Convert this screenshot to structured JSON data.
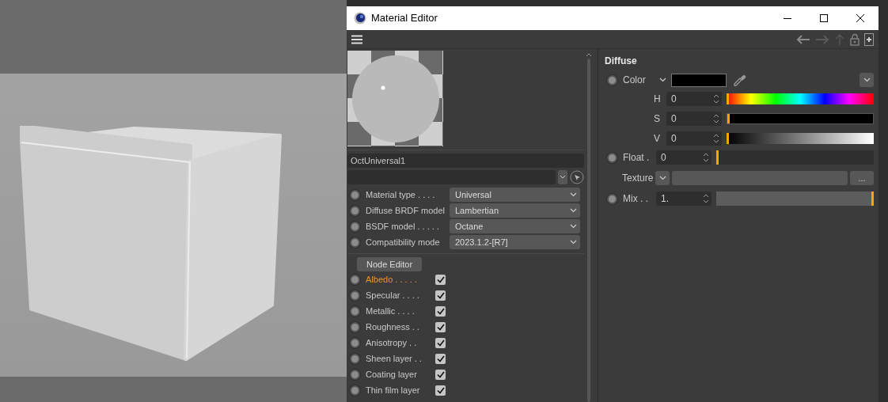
{
  "window": {
    "title": "Material Editor"
  },
  "material": {
    "name": "OctUniversal1",
    "properties": [
      {
        "label": "Material type . . . .",
        "value": "Universal"
      },
      {
        "label": "Diffuse BRDF model",
        "value": "Lambertian"
      },
      {
        "label": "BSDF model . . . . .",
        "value": "Octane"
      },
      {
        "label": "Compatibility mode",
        "value": "2023.1.2-[R7]"
      }
    ],
    "node_editor_button": "Node Editor",
    "channels": [
      {
        "label": "Albedo . . . . .",
        "selected": true,
        "checked": true
      },
      {
        "label": "Specular . . . .",
        "selected": false,
        "checked": true
      },
      {
        "label": "Metallic . . . .",
        "selected": false,
        "checked": true
      },
      {
        "label": "Roughness . .",
        "selected": false,
        "checked": true
      },
      {
        "label": "Anisotropy . .",
        "selected": false,
        "checked": true
      },
      {
        "label": "Sheen layer . .",
        "selected": false,
        "checked": true
      },
      {
        "label": "Coating layer",
        "selected": false,
        "checked": true
      },
      {
        "label": "Thin film layer",
        "selected": false,
        "checked": true
      }
    ]
  },
  "diffuse": {
    "title": "Diffuse",
    "color_label": "Color",
    "hsv": [
      {
        "label": "H",
        "value": "0",
        "kind": "hue",
        "level": 0
      },
      {
        "label": "S",
        "value": "0",
        "kind": "saturation",
        "level": 0
      },
      {
        "label": "V",
        "value": "0",
        "kind": "value",
        "level": 0
      }
    ],
    "float": {
      "label": "Float .",
      "value": "0",
      "level": 0
    },
    "texture": {
      "label": "Texture",
      "browse_button": "..."
    },
    "mix": {
      "label": "Mix . .",
      "value": "1.",
      "level": 1
    }
  }
}
